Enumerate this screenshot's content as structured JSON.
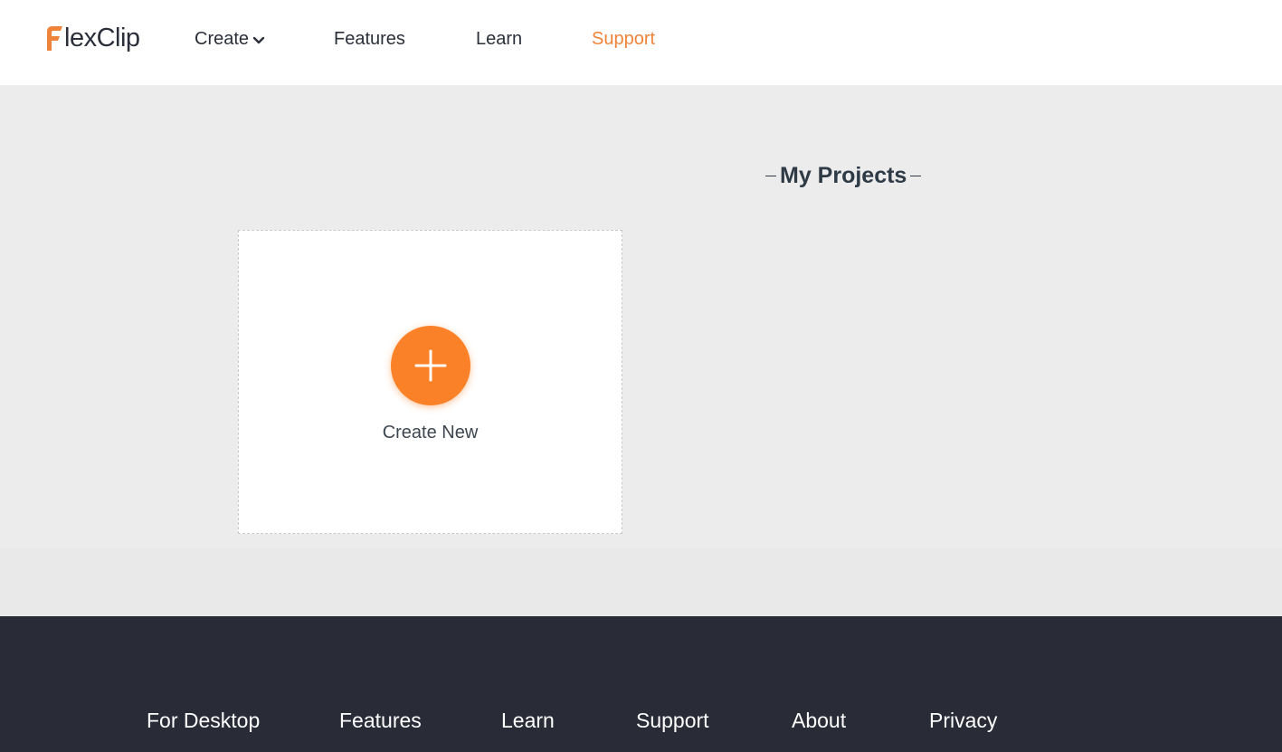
{
  "brand": {
    "name": "FlexClip",
    "logo_text_rest": "lexClip",
    "accent_color": "#f0833a"
  },
  "nav": {
    "items": [
      {
        "label": "Create",
        "has_dropdown": true,
        "active": false
      },
      {
        "label": "Features",
        "active": false
      },
      {
        "label": "Learn",
        "active": false
      },
      {
        "label": "Support",
        "active": true
      }
    ],
    "dropdown_icon": "chevron-down-icon"
  },
  "main": {
    "section_title": "My Projects",
    "create_card": {
      "label": "Create New",
      "icon": "plus-icon",
      "button_color": "#fb8129"
    }
  },
  "footer": {
    "background": "#292b36",
    "links": [
      {
        "label": "For Desktop"
      },
      {
        "label": "Features"
      },
      {
        "label": "Learn"
      },
      {
        "label": "Support"
      },
      {
        "label": "About"
      },
      {
        "label": "Privacy"
      }
    ]
  }
}
